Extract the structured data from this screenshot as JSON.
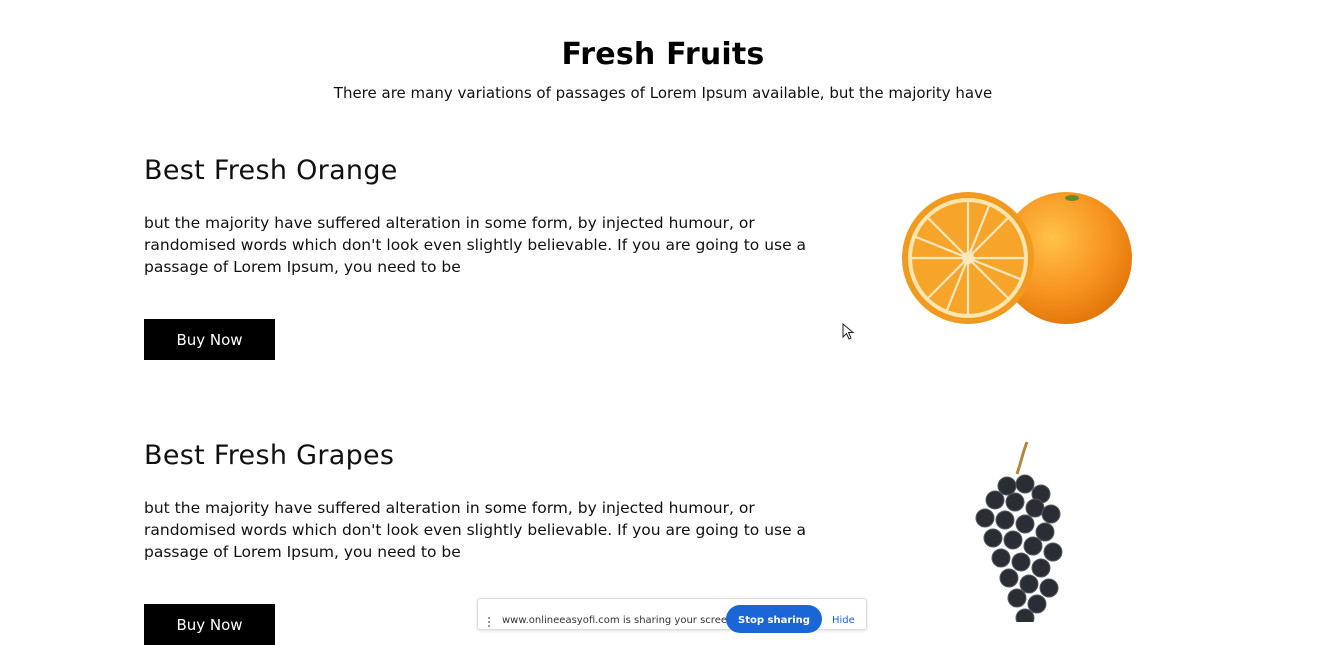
{
  "header": {
    "title": "Fresh Fruits",
    "subtitle": "There are many variations of passages of Lorem Ipsum available, but the majority have"
  },
  "products": [
    {
      "title": "Best Fresh Orange",
      "description": "but the majority have suffered alteration in some form, by injected humour, or randomised words which don't look even slightly believable. If you are going to use a passage of Lorem Ipsum, you need to be",
      "button_label": "Buy Now",
      "image_icon": "orange-image"
    },
    {
      "title": "Best Fresh Grapes",
      "description": "but the majority have suffered alteration in some form, by injected humour, or randomised words which don't look even slightly believable. If you are going to use a passage of Lorem Ipsum, you need to be",
      "button_label": "Buy Now",
      "image_icon": "grapes-image"
    }
  ],
  "share_bar": {
    "message": "www.onlineeasyofi.com is sharing your screen",
    "stop_label": "Stop sharing",
    "hide_label": "Hide"
  },
  "colors": {
    "button_bg": "#000000",
    "stop_button_bg": "#1a66d6",
    "orange": "#f7931e"
  }
}
